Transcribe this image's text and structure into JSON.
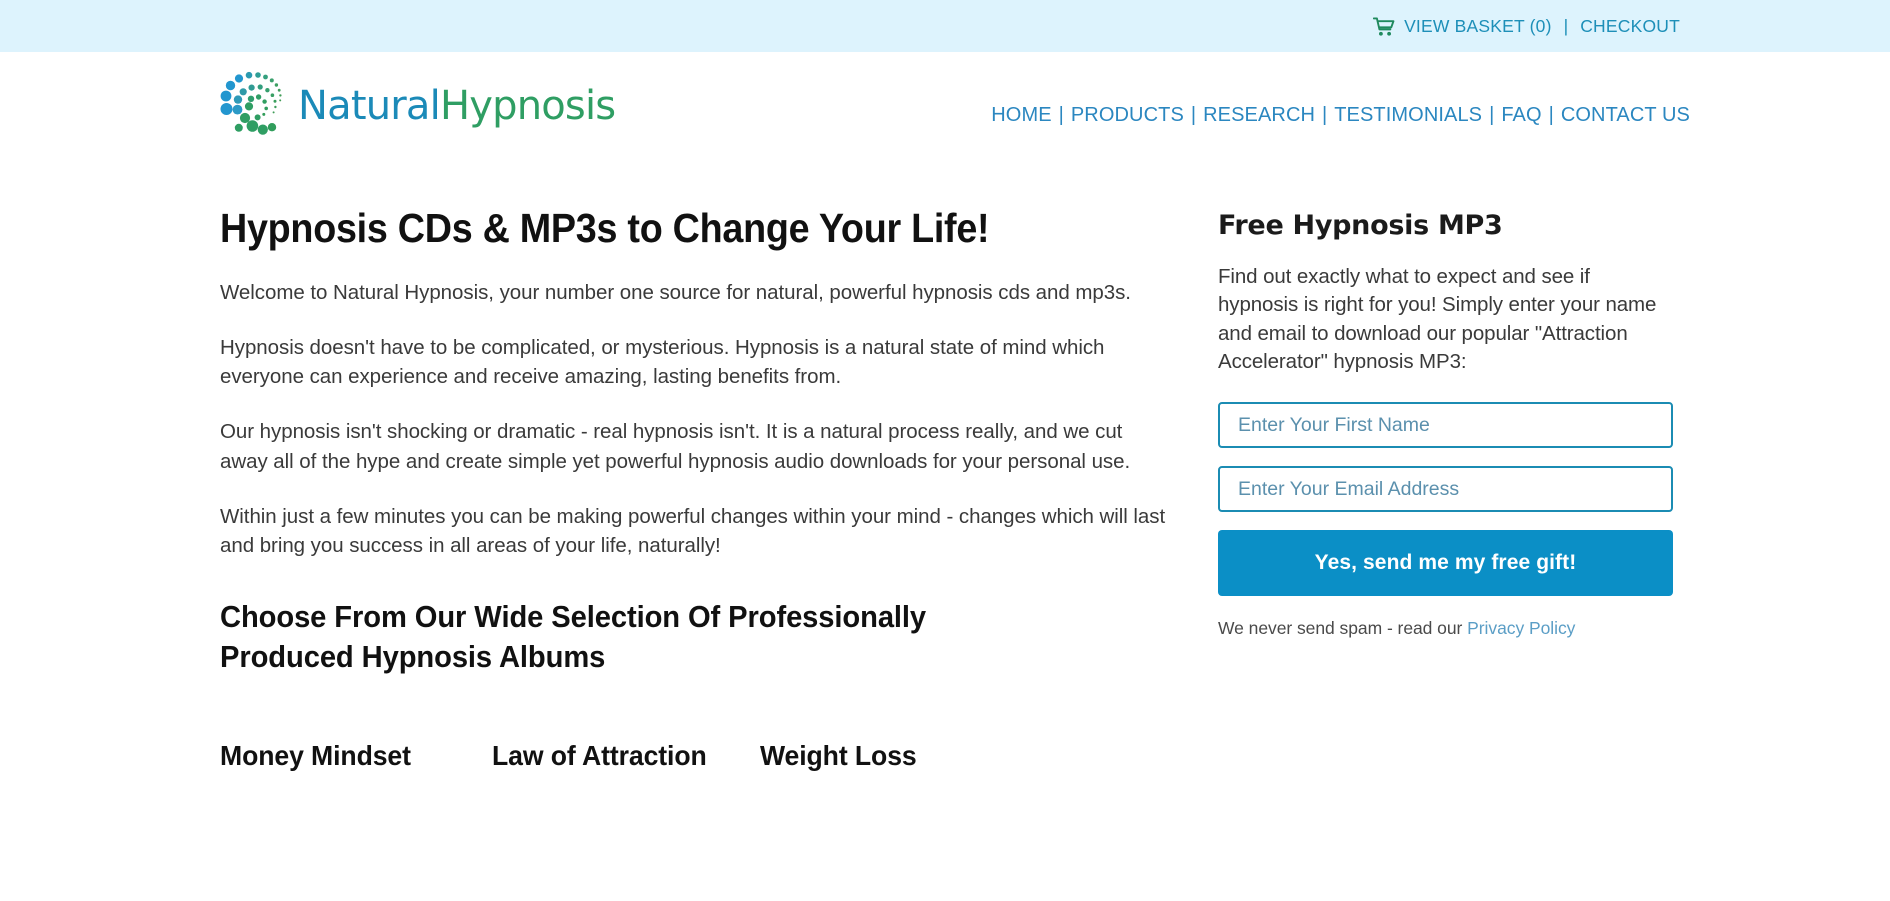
{
  "topbar": {
    "cart_icon": "shopping-cart-icon",
    "basket_label": "VIEW BASKET (0)",
    "separator": "|",
    "checkout_label": "CHECKOUT",
    "background_color": "#ddf3fd",
    "link_color": "#1d8fb8",
    "cart_icon_color": "#1f8a5e"
  },
  "header": {
    "logo": {
      "icon": "dot-spiral-logo-icon",
      "text_first": "Natural",
      "text_second": "Hypnosis",
      "color_first": "#1b8ab8",
      "color_second": "#2f9e63"
    },
    "nav": {
      "separator": "|",
      "link_color": "#2b87c0",
      "items": [
        {
          "label": "HOME"
        },
        {
          "label": "PRODUCTS"
        },
        {
          "label": "RESEARCH"
        },
        {
          "label": "TESTIMONIALS"
        },
        {
          "label": "FAQ"
        },
        {
          "label": "CONTACT US"
        }
      ]
    }
  },
  "main": {
    "title": "Hypnosis CDs & MP3s to Change Your Life!",
    "paragraphs": [
      "Welcome to Natural Hypnosis, your number one source for natural, powerful hypnosis cds and mp3s.",
      "Hypnosis doesn't have to be complicated, or mysterious. Hypnosis is a natural state of mind which everyone can experience and receive amazing, lasting benefits from.",
      "Our hypnosis isn't shocking or dramatic - real hypnosis isn't. It is a natural process really, and we cut away all of the hype and create simple yet powerful hypnosis audio downloads for your personal use.",
      "Within just a few minutes you can be making powerful changes within your mind - changes which will last and bring you success in all areas of your life, naturally!"
    ],
    "section_title": "Choose From Our Wide Selection Of Professionally Produced Hypnosis Albums",
    "categories": [
      {
        "label": "Money Mindset"
      },
      {
        "label": "Law of Attraction"
      },
      {
        "label": "Weight Loss"
      }
    ]
  },
  "sidebar": {
    "title": "Free Hypnosis MP3",
    "description": "Find out exactly what to expect and see if hypnosis is right for you! Simply enter your name and email to download our popular \"Attraction Accelerator\" hypnosis MP3:",
    "first_name_placeholder": "Enter Your First Name",
    "first_name_value": "",
    "email_placeholder": "Enter Your Email Address",
    "email_value": "",
    "cta_label": "Yes, send me my free gift!",
    "cta_color": "#0b8fc6",
    "privacy_text": "We never send spam - read our",
    "privacy_link_label": "Privacy Policy",
    "field_border_color": "#1b8cb3"
  }
}
